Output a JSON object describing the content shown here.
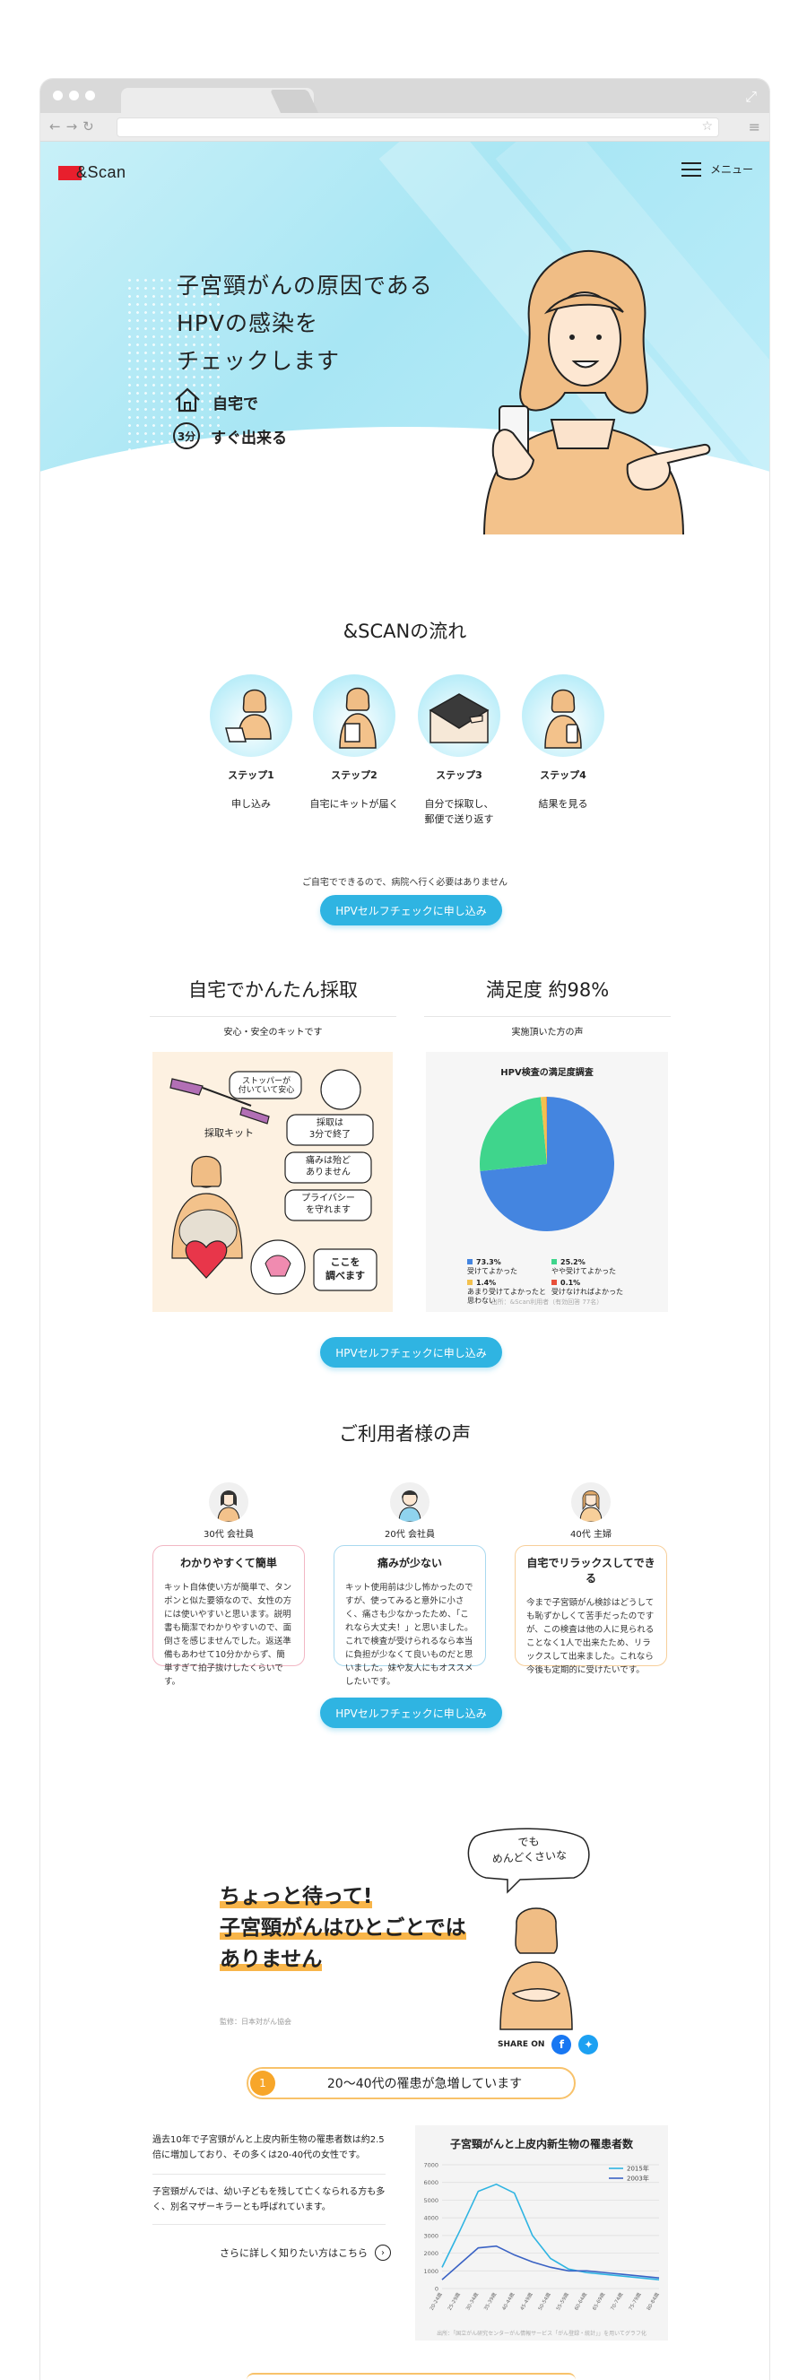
{
  "header": {
    "logo_text": "&Scan",
    "menu_label": "メニュー"
  },
  "hero": {
    "title_lines": [
      "子宮頸がんの原因である",
      "HPVの感染を",
      "チェックします"
    ],
    "features": [
      {
        "icon": "home-icon",
        "label": "自宅で"
      },
      {
        "icon": "three-minutes-icon",
        "icon_text": "3分",
        "label": "すぐ出来る"
      }
    ]
  },
  "flow": {
    "title": "&SCANの流れ",
    "steps": [
      {
        "label": "ステップ1",
        "desc": "申し込み"
      },
      {
        "label": "ステップ2",
        "desc": "自宅にキットが届く"
      },
      {
        "label": "ステップ3",
        "desc": "自分で採取し、\n郵便で送り返す"
      },
      {
        "label": "ステップ4",
        "desc": "結果を見る"
      }
    ],
    "note": "ご自宅でできるので、病院へ行く必要はありません"
  },
  "cta_label": "HPVセルフチェックに申し込み",
  "kit": {
    "title": "自宅でかんたん採取",
    "subtitle": "安心・安全のキットです",
    "bubbles": [
      "ストッパーが\n付いていて安心",
      "採取キット",
      "採取は\n3分で終了",
      "痛みは殆ど\nありません",
      "プライバシー\nを守れます",
      "ここを\n調べます"
    ]
  },
  "satisfaction": {
    "title": "満足度 約98%",
    "subtitle": "実施頂いた方の声",
    "chart_title": "HPV検査の満足度調査",
    "source": "出所：&Scan利用者（有効回答 77名）"
  },
  "chart_data": [
    {
      "type": "pie",
      "title": "HPV検査の満足度調査",
      "categories": [
        "受けてよかった",
        "やや受けてよかった",
        "あまり受けてよかったと思わない",
        "受けなければよかった"
      ],
      "values": [
        73.3,
        25.2,
        1.4,
        0.1
      ],
      "labels_printed": [
        "73.3%",
        "25.2%",
        "1.4%",
        "0.1%"
      ],
      "colors": [
        "#4485e0",
        "#3fd58c",
        "#f3c14e",
        "#e8503a"
      ]
    },
    {
      "type": "line",
      "title": "子宮頸がんと上皮内新生物の罹患者数",
      "x": [
        "20-24歳",
        "25-29歳",
        "30-34歳",
        "35-39歳",
        "40-44歳",
        "45-49歳",
        "50-54歳",
        "55-59歳",
        "60-64歳",
        "65-69歳",
        "70-74歳",
        "75-79歳",
        "80-84歳"
      ],
      "series": [
        {
          "name": "2015年",
          "values": [
            1200,
            3300,
            5500,
            5900,
            5400,
            3000,
            1700,
            1100,
            900,
            800,
            700,
            600,
            500
          ],
          "color": "#2fb4e2"
        },
        {
          "name": "2003年",
          "values": [
            500,
            1400,
            2300,
            2400,
            1900,
            1500,
            1200,
            1000,
            1000,
            900,
            800,
            700,
            600
          ],
          "color": "#3a62c4"
        }
      ],
      "ylim": [
        0,
        7000
      ],
      "yticks": [
        0,
        1000,
        2000,
        3000,
        4000,
        5000,
        6000,
        7000
      ],
      "grid": true,
      "legend": "top-right"
    }
  ],
  "voices": {
    "title": "ご利用者様の声",
    "items": [
      {
        "person": "30代 会社員",
        "title": "わかりやすくて簡単",
        "text": "キット自体使い方が簡単で、タンポンと似た要領なので、女性の方には使いやすいと思います。説明書も簡潔でわかりやすいので、面倒さを感じませんでした。返送準備もあわせて10分かからず、簡単すぎて拍子抜けしたくらいです。",
        "border": "#f2b7c4"
      },
      {
        "person": "20代 会社員",
        "title": "痛みが少ない",
        "text": "キット使用前は少し怖かったのですが、使ってみると意外に小さく、痛さも少なかったため、「これなら大丈夫！」と思いました。これで検査が受けられるなら本当に負担が少なくて良いものだと思いました。妹や友人にもオススメしたいです。",
        "border": "#a9d9ef"
      },
      {
        "person": "40代 主婦",
        "title": "自宅でリラックスしてできる",
        "text": "今まで子宮頸がん検診はどうしても恥ずかしくて苦手だったのですが、この検査は他の人に見られることなく1人で出来たため、リラックスして出来ました。これなら今後も定期的に受けたいです。",
        "border": "#f7cf9a"
      }
    ]
  },
  "wait": {
    "bubble": "でも\nめんどくさいな",
    "title_lines": [
      "ちょっと待って!",
      "子宮頸がんはひとごとでは",
      "ありません"
    ],
    "supervise": "監修：日本対がん協会",
    "share_label": "SHARE ON"
  },
  "info": {
    "pill_number": "1",
    "pill_text": "20〜40代の罹患が急増しています",
    "paragraphs": [
      "過去10年で子宮頸がんと上皮内新生物の罹患者数は約2.5倍に増加しており、その多くは20-40代の女性です。",
      "子宮頸がんでは、幼い子どもを残して亡くなられる方も多く、別名マザーキラーとも呼ばれています。"
    ],
    "more_link": "さらに詳しく知りたい方はこちら",
    "chart_title": "子宮頸がんと上皮内新生物の罹患者数",
    "chart_source": "出所：「国立がん研究センターがん情報サービス「がん登録・統計」」を用いてグラフ化"
  }
}
